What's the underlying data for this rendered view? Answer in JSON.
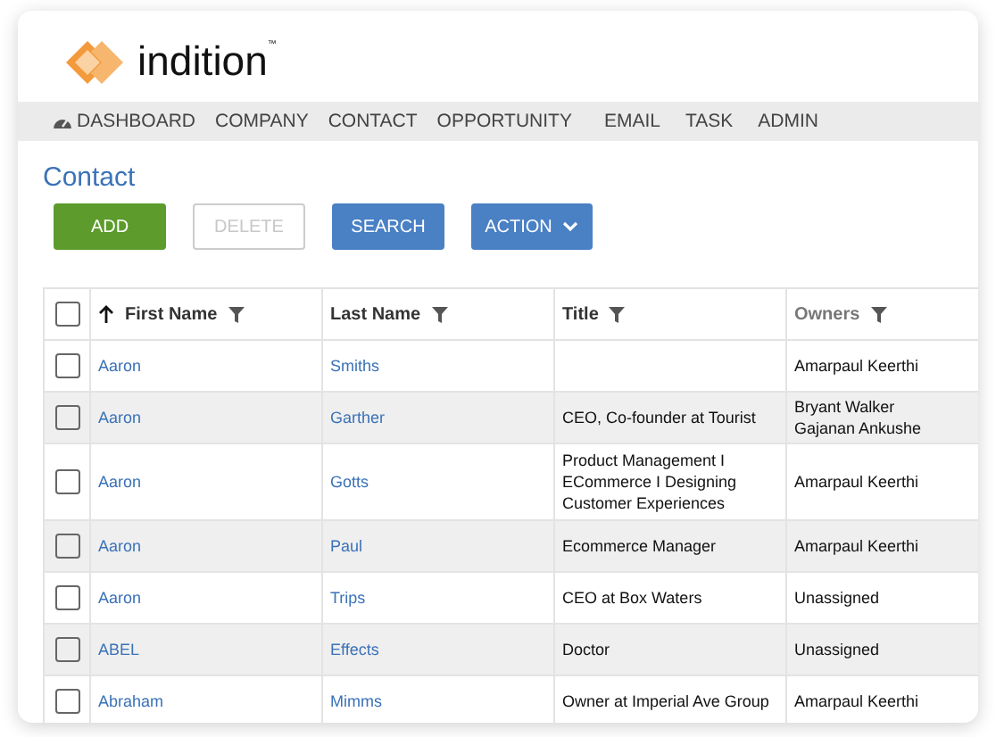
{
  "logo": {
    "text": "indition",
    "mark": "™"
  },
  "nav": [
    {
      "label": "DASHBOARD",
      "icon": true
    },
    {
      "label": "COMPANY",
      "icon": false
    },
    {
      "label": "CONTACT",
      "icon": false
    },
    {
      "label": "OPPORTUNITY",
      "icon": false
    },
    {
      "label": "EMAIL",
      "icon": false
    },
    {
      "label": "TASK",
      "icon": false
    },
    {
      "label": "ADMIN",
      "icon": false
    }
  ],
  "page_title": "Contact",
  "buttons": [
    {
      "label": "ADD",
      "kind": "primary",
      "disabled": false
    },
    {
      "label": "DELETE",
      "kind": "outline",
      "disabled": true
    },
    {
      "label": "SEARCH",
      "kind": "info",
      "disabled": false
    },
    {
      "label": "ACTION",
      "kind": "dropdown",
      "disabled": false
    }
  ],
  "table": {
    "select_all_checked": false,
    "columns": [
      {
        "label": "First Name",
        "sorted": true,
        "muted": false
      },
      {
        "label": "Last Name",
        "sorted": false,
        "muted": false
      },
      {
        "label": "Title",
        "sorted": false,
        "muted": false
      },
      {
        "label": "Owners",
        "sorted": false,
        "muted": true
      }
    ],
    "rows": [
      {
        "checked": false,
        "first_name": "Aaron",
        "last_name": "Smiths",
        "owners": [
          "Amarpaul Keerthi"
        ]
      },
      {
        "checked": false,
        "first_name": "Aaron",
        "last_name": "Garther",
        "title": "CEO, Co-founder at Tourist",
        "owners": [
          "Bryant Walker",
          "Gajanan Ankushe"
        ]
      },
      {
        "checked": false,
        "first_name": "Aaron",
        "last_name": "Gotts",
        "title": "Product Management I ECommerce I Designing Customer Experiences",
        "owners": [
          "Amarpaul Keerthi"
        ]
      },
      {
        "checked": false,
        "first_name": "Aaron",
        "last_name": "Paul",
        "title": "Ecommerce Manager",
        "owners": [
          "Amarpaul Keerthi"
        ]
      },
      {
        "checked": false,
        "first_name": "Aaron",
        "last_name": "Trips",
        "title": "CEO at Box Waters",
        "owners": [
          "Unassigned"
        ]
      },
      {
        "checked": false,
        "first_name": "ABEL",
        "last_name": "Effects",
        "title": "Doctor",
        "owners": [
          "Unassigned"
        ]
      },
      {
        "checked": false,
        "first_name": "Abraham",
        "last_name": "Mimms",
        "title": "Owner at Imperial Ave Group",
        "owners": [
          "Amarpaul Keerthi"
        ]
      }
    ]
  }
}
